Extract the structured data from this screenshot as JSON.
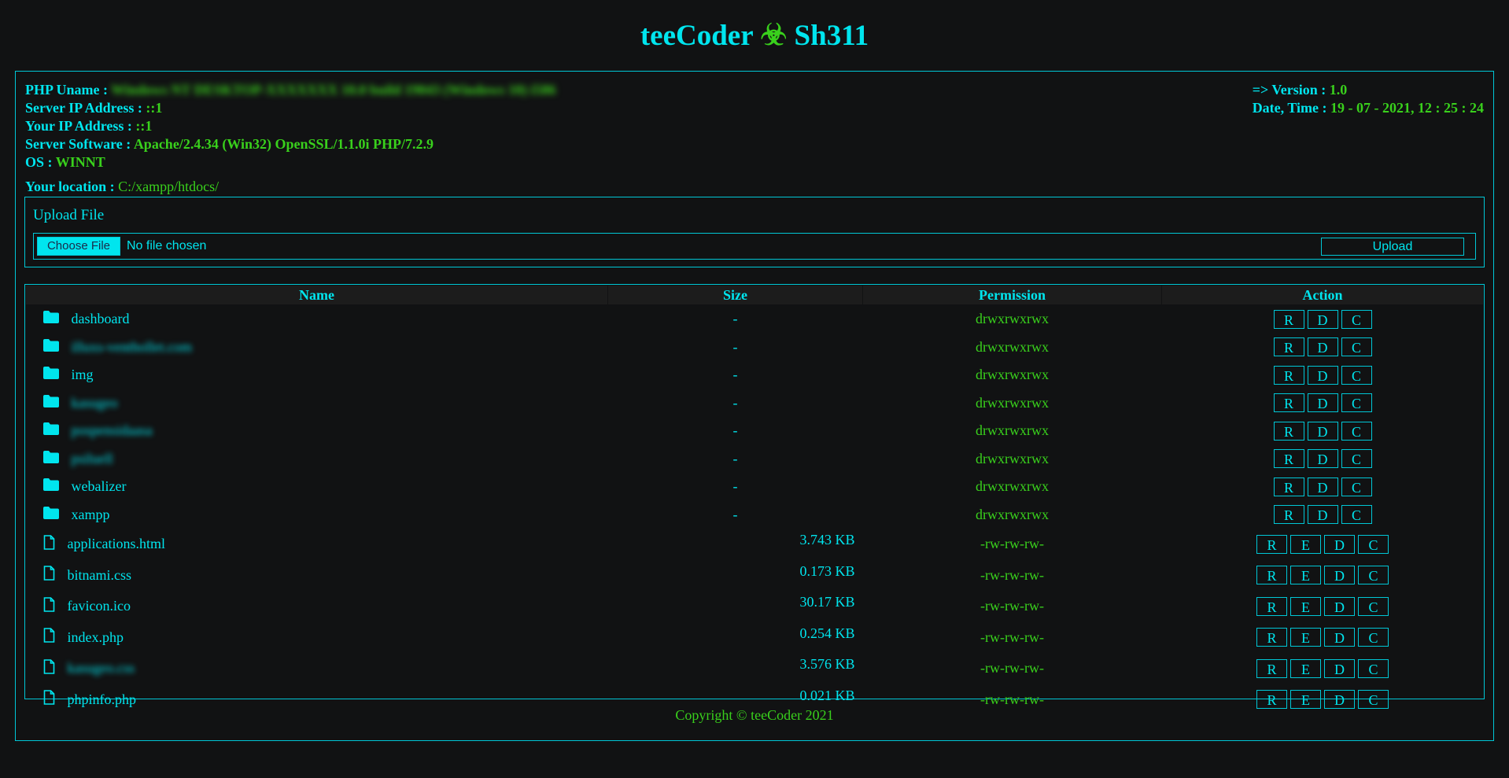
{
  "title": {
    "left": "teeCoder",
    "icon": "☣",
    "right": "Sh311"
  },
  "info": {
    "uname_label": "PHP Uname :",
    "uname_value": "Windows NT DESKTOP-XXXXXXX 10.0 build 19043 (Windows 10) i586",
    "server_ip_label": "Server IP Address :",
    "server_ip_value": "::1",
    "your_ip_label": "Your IP Address :",
    "your_ip_value": "::1",
    "software_label": "Server Software :",
    "software_value": "Apache/2.4.34 (Win32) OpenSSL/1.1.0i PHP/7.2.9",
    "os_label": "OS :",
    "os_value": "WINNT",
    "version_label": "=> Version :",
    "version_value": "1.0",
    "datetime_label": "Date, Time :",
    "datetime_value": "19 - 07 - 2021, 12 : 25 : 24",
    "location_label": "Your location :",
    "location_value": "C:/xampp/htdocs/"
  },
  "upload": {
    "title": "Upload File",
    "choose_label": "Choose File",
    "no_file": "No file chosen",
    "upload_label": "Upload"
  },
  "table": {
    "headers": [
      "Name",
      "Size",
      "Permission",
      "Action"
    ],
    "rows": [
      {
        "type": "folder",
        "name": "dashboard",
        "size": "-",
        "perm": "drwxrwxrwx",
        "actions": [
          "R",
          "D",
          "C"
        ]
      },
      {
        "type": "folder",
        "name": "illuxs-venthollet.com",
        "size": "-",
        "perm": "drwxrwxrwx",
        "actions": [
          "R",
          "D",
          "C"
        ]
      },
      {
        "type": "folder",
        "name": "img",
        "size": "-",
        "perm": "drwxrwxrwx",
        "actions": [
          "R",
          "D",
          "C"
        ]
      },
      {
        "type": "folder",
        "name": "kasugeo",
        "size": "-",
        "perm": "drwxrwxrwx",
        "actions": [
          "R",
          "D",
          "C"
        ]
      },
      {
        "type": "folder",
        "name": "pospensidaasa",
        "size": "-",
        "perm": "drwxrwxrwx",
        "actions": [
          "R",
          "D",
          "C"
        ]
      },
      {
        "type": "folder",
        "name": "psiluell",
        "size": "-",
        "perm": "drwxrwxrwx",
        "actions": [
          "R",
          "D",
          "C"
        ]
      },
      {
        "type": "folder",
        "name": "webalizer",
        "size": "-",
        "perm": "drwxrwxrwx",
        "actions": [
          "R",
          "D",
          "C"
        ]
      },
      {
        "type": "folder",
        "name": "xampp",
        "size": "-",
        "perm": "drwxrwxrwx",
        "actions": [
          "R",
          "D",
          "C"
        ]
      },
      {
        "type": "file",
        "name": "applications.html",
        "size": "3.743 KB",
        "perm": "-rw-rw-rw-",
        "actions": [
          "R",
          "E",
          "D",
          "C"
        ]
      },
      {
        "type": "file",
        "name": "bitnami.css",
        "size": "0.173 KB",
        "perm": "-rw-rw-rw-",
        "actions": [
          "R",
          "E",
          "D",
          "C"
        ]
      },
      {
        "type": "file",
        "name": "favicon.ico",
        "size": "30.17 KB",
        "perm": "-rw-rw-rw-",
        "actions": [
          "R",
          "E",
          "D",
          "C"
        ]
      },
      {
        "type": "file",
        "name": "index.php",
        "size": "0.254 KB",
        "perm": "-rw-rw-rw-",
        "actions": [
          "R",
          "E",
          "D",
          "C"
        ]
      },
      {
        "type": "file",
        "name": "kasugeo.css",
        "size": "3.576 KB",
        "perm": "-rw-rw-rw-",
        "actions": [
          "R",
          "E",
          "D",
          "C"
        ]
      },
      {
        "type": "file",
        "name": "phpinfo.php",
        "size": "0.021 KB",
        "perm": "-rw-rw-rw-",
        "actions": [
          "R",
          "E",
          "D",
          "C"
        ]
      }
    ]
  },
  "footer": "Copyright © teeCoder 2021",
  "colors": {
    "accent": "#00e5ee",
    "green": "#39d01c",
    "background": "#111213"
  }
}
